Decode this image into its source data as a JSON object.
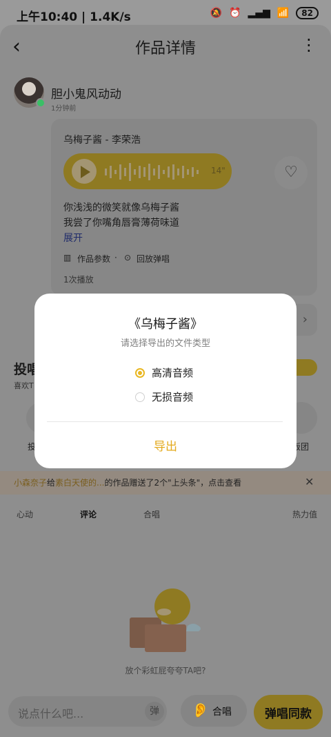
{
  "status_bar": {
    "time": "上午10:40",
    "speed": "1.4K/s",
    "battery": "82"
  },
  "header": {
    "title": "作品详情"
  },
  "post": {
    "username": "胆小鬼风动动",
    "time": "1分钟前",
    "song": "乌梅子酱 - 李荣浩",
    "duration": "14\"",
    "lyrics": [
      "你浅浅的微笑就像乌梅子酱",
      "我尝了你嘴角唇膏薄荷味道"
    ],
    "expand": "展开",
    "params_label": "作品参数",
    "replay_label": "回放弹唱",
    "plays": "1次播放"
  },
  "section": {
    "title_partial": "投唱",
    "sub_partial": "喜欢T",
    "icon_left_label": "投",
    "icon_right_label": "饭团"
  },
  "notice": {
    "user1": "小森奈子",
    "give": "给",
    "user2": "素白天使的...",
    "rest": "的作品赠送了2个\"上头条\"，点击查看"
  },
  "tabs": {
    "items": [
      "心动",
      "评论",
      "合唱"
    ],
    "right": "热力值",
    "active_index": 1
  },
  "empty": {
    "text": "放个彩虹屁夸夸TA吧?"
  },
  "bottom": {
    "input_placeholder": "说点什么吧...",
    "danmu": "弹",
    "duet": "合唱",
    "sing": "弹唱同款"
  },
  "dialog": {
    "title": "《乌梅子酱》",
    "subtitle": "请选择导出的文件类型",
    "options": [
      {
        "label": "高清音频",
        "selected": true
      },
      {
        "label": "无损音频",
        "selected": false
      }
    ],
    "confirm": "导出"
  },
  "colors": {
    "accent": "#e9b721",
    "export_text": "#e3a91c",
    "overlay_yellow": "#8f7a22"
  }
}
